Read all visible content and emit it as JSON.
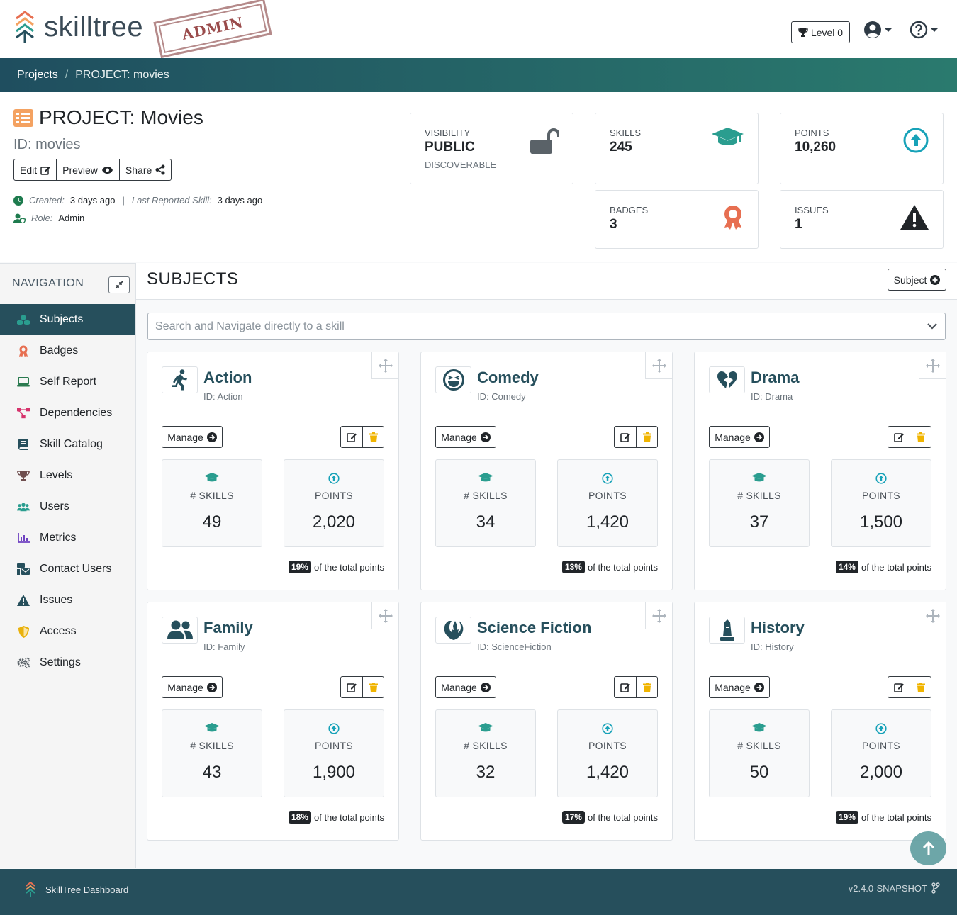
{
  "header": {
    "logo_text": "skilltree",
    "admin_stamp": "ADMIN",
    "level_label": "Level 0"
  },
  "breadcrumb": {
    "root": "Projects",
    "current": "PROJECT: movies"
  },
  "project": {
    "title": "PROJECT: Movies",
    "id_text": "ID: movies",
    "buttons": {
      "edit": "Edit",
      "preview": "Preview",
      "share": "Share"
    },
    "created_label": "Created:",
    "created_value": "3 days ago",
    "separator": "|",
    "last_reported_label": "Last Reported Skill:",
    "last_reported_value": "3 days ago",
    "role_label": "Role:",
    "role_value": "Admin"
  },
  "stats": {
    "visibility": {
      "label": "VISIBILITY",
      "value": "PUBLIC",
      "sub": "DISCOVERABLE"
    },
    "skills": {
      "label": "SKILLS",
      "value": "245"
    },
    "points": {
      "label": "POINTS",
      "value": "10,260"
    },
    "badges": {
      "label": "BADGES",
      "value": "3"
    },
    "issues": {
      "label": "ISSUES",
      "value": "1"
    }
  },
  "navigation": {
    "title": "NAVIGATION",
    "items": [
      {
        "label": "Subjects",
        "icon": "cubes-icon",
        "color": "#2a9d8f"
      },
      {
        "label": "Badges",
        "icon": "award-icon",
        "color": "#e76f51"
      },
      {
        "label": "Self Report",
        "icon": "laptop-icon",
        "color": "#2a7a4f"
      },
      {
        "label": "Dependencies",
        "icon": "project-diagram-icon",
        "color": "#d6336c"
      },
      {
        "label": "Skill Catalog",
        "icon": "book-icon",
        "color": "#264f5c"
      },
      {
        "label": "Levels",
        "icon": "trophy-icon",
        "color": "#6f4e4e"
      },
      {
        "label": "Users",
        "icon": "users-icon",
        "color": "#2a9d8f"
      },
      {
        "label": "Metrics",
        "icon": "chart-bar-icon",
        "color": "#6f42c1"
      },
      {
        "label": "Contact Users",
        "icon": "mail-bulk-icon",
        "color": "#264f5c"
      },
      {
        "label": "Issues",
        "icon": "exclamation-triangle-icon",
        "color": "#264f5c"
      },
      {
        "label": "Access",
        "icon": "shield-icon",
        "color": "#e9b10b"
      },
      {
        "label": "Settings",
        "icon": "cogs-icon",
        "color": "#5a6268"
      }
    ]
  },
  "main": {
    "title": "SUBJECTS",
    "add_subject_label": "Subject",
    "search_placeholder": "Search and Navigate directly to a skill",
    "skills_label": "# SKILLS",
    "points_label": "POINTS",
    "manage_label": "Manage",
    "pct_suffix": "of the total points",
    "subjects": [
      {
        "name": "Action",
        "id_text": "ID: Action",
        "icon": "running-icon",
        "skills": "49",
        "points": "2,020",
        "pct": "19%"
      },
      {
        "name": "Comedy",
        "id_text": "ID: Comedy",
        "icon": "laugh-squint-icon",
        "skills": "34",
        "points": "1,420",
        "pct": "13%"
      },
      {
        "name": "Drama",
        "id_text": "ID: Drama",
        "icon": "heart-broken-icon",
        "skills": "37",
        "points": "1,500",
        "pct": "14%"
      },
      {
        "name": "Family",
        "id_text": "ID: Family",
        "icon": "user-friends-icon",
        "skills": "43",
        "points": "1,900",
        "pct": "18%"
      },
      {
        "name": "Science Fiction",
        "id_text": "ID: ScienceFiction",
        "icon": "jedi-order-icon",
        "skills": "32",
        "points": "1,420",
        "pct": "17%"
      },
      {
        "name": "History",
        "id_text": "ID: History",
        "icon": "monument-icon",
        "skills": "50",
        "points": "2,000",
        "pct": "19%"
      }
    ]
  },
  "footer": {
    "app_name": "SkillTree Dashboard",
    "version": "v2.4.0-SNAPSHOT"
  },
  "colors": {
    "primary": "#264f5c",
    "teal": "#2a9d8f",
    "cyan": "#17a2b8",
    "orange": "#f4a261",
    "trash": "#f0b400"
  }
}
